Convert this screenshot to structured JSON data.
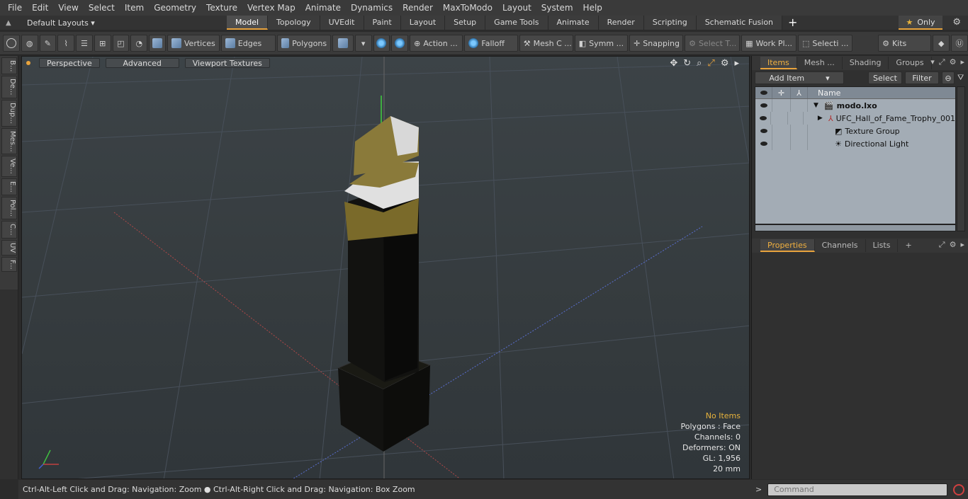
{
  "menu": [
    "File",
    "Edit",
    "View",
    "Select",
    "Item",
    "Geometry",
    "Texture",
    "Vertex Map",
    "Animate",
    "Dynamics",
    "Render",
    "MaxToModo",
    "Layout",
    "System",
    "Help"
  ],
  "layout": {
    "dropdown": "Default Layouts ▾",
    "tabs": [
      "Model",
      "Topology",
      "UVEdit",
      "Paint",
      "Layout",
      "Setup",
      "Game Tools",
      "Animate",
      "Render",
      "Scripting",
      "Schematic Fusion"
    ],
    "active_tab": "Model",
    "plus": "+",
    "only_label": "Only",
    "star": "★"
  },
  "toolbar": {
    "vertices": "Vertices",
    "edges": "Edges",
    "polygons": "Polygons",
    "action": "Action ...",
    "falloff": "Falloff",
    "meshc": "Mesh C ...",
    "symm": "Symm ...",
    "snapping": "Snapping",
    "selectt": "Select T...",
    "workpl": "Work Pl...",
    "selecti": "Selecti ...",
    "kits": "Kits"
  },
  "left_tabs": [
    "B...",
    "De...",
    "Dup...",
    "Mes...",
    "Ve...",
    "E...",
    "Pol...",
    "C...",
    "UV",
    "F..."
  ],
  "viewport": {
    "perspective": "Perspective",
    "advanced": "Advanced",
    "viewport_textures": "Viewport Textures",
    "info": {
      "no_items": "No Items",
      "polygons": "Polygons : Face",
      "channels": "Channels: 0",
      "deformers": "Deformers: ON",
      "gl": "GL: 1,956",
      "scale": "20 mm"
    }
  },
  "status": "Ctrl-Alt-Left Click and Drag: Navigation: Zoom ● Ctrl-Alt-Right Click and Drag: Navigation: Box Zoom",
  "items_panel": {
    "tabs": [
      "Items",
      "Mesh ...",
      "Shading",
      "Groups"
    ],
    "active_tab": "Items",
    "add_item": "Add Item",
    "select": "Select",
    "filter": "Filter",
    "name_header": "Name",
    "rows": [
      {
        "label": "modo.lxo",
        "indent": 0
      },
      {
        "label": "UFC_Hall_of_Fame_Trophy_001",
        "indent": 1
      },
      {
        "label": "Texture Group",
        "indent": 1
      },
      {
        "label": "Directional Light",
        "indent": 1
      }
    ]
  },
  "props_panel": {
    "tabs": [
      "Properties",
      "Channels",
      "Lists"
    ],
    "active_tab": "Properties",
    "plus": "+"
  },
  "command": {
    "prompt": ">",
    "placeholder": "Command"
  },
  "colors": {
    "accent": "#e8a33c",
    "grid_red": "#c0504d",
    "grid_blue": "#5a6fd0",
    "grid_green": "#40d040"
  }
}
